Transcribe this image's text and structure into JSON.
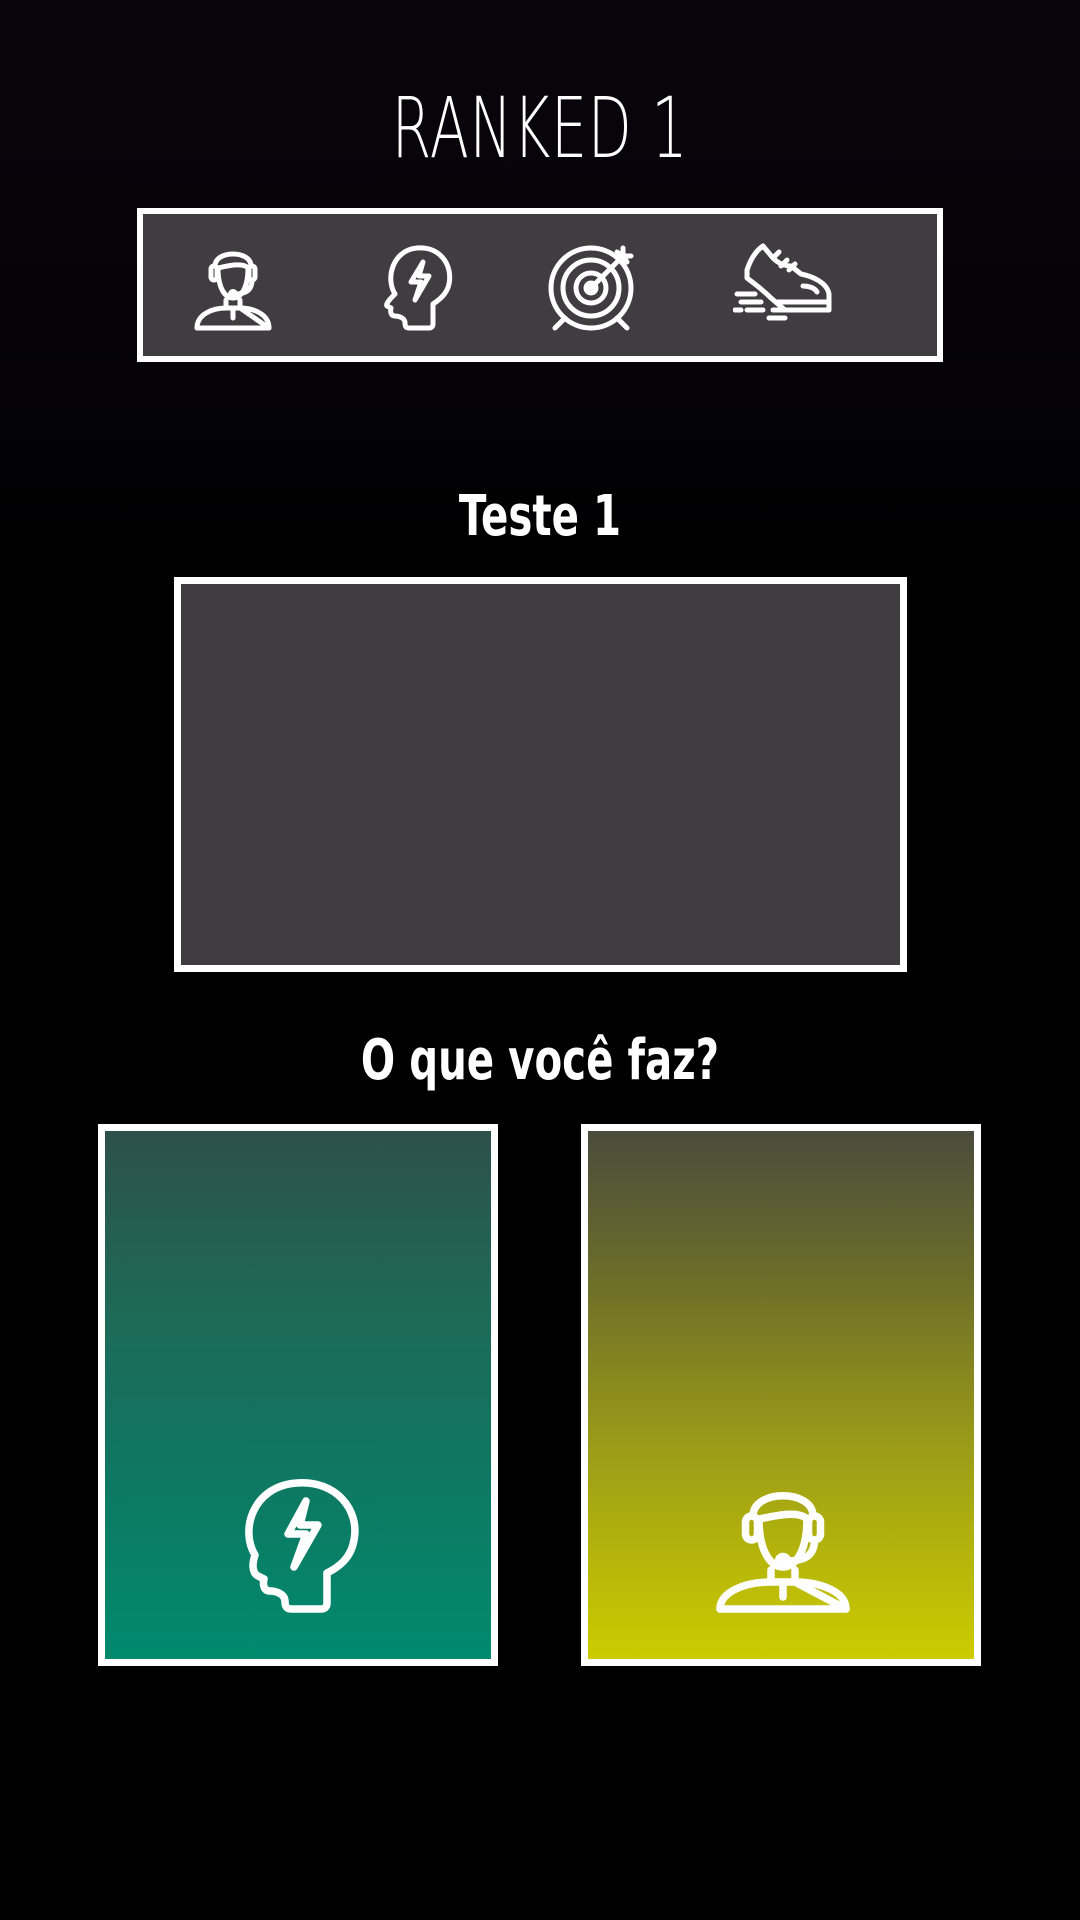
{
  "screen": {
    "title": "RANKED 1"
  },
  "stats_bar": {
    "icons": [
      "operator-icon",
      "brain-lightning-icon",
      "target-icon",
      "sneaker-icon"
    ]
  },
  "test": {
    "heading": "Teste 1"
  },
  "question": {
    "text": "O que você faz?"
  },
  "choices": [
    {
      "icon": "brain-lightning-icon",
      "color": "#008a6d"
    },
    {
      "icon": "operator-icon",
      "color": "#cdcc00"
    }
  ],
  "colors": {
    "background": "#000000",
    "panel": "#3f3d40",
    "border": "#ffffff"
  }
}
